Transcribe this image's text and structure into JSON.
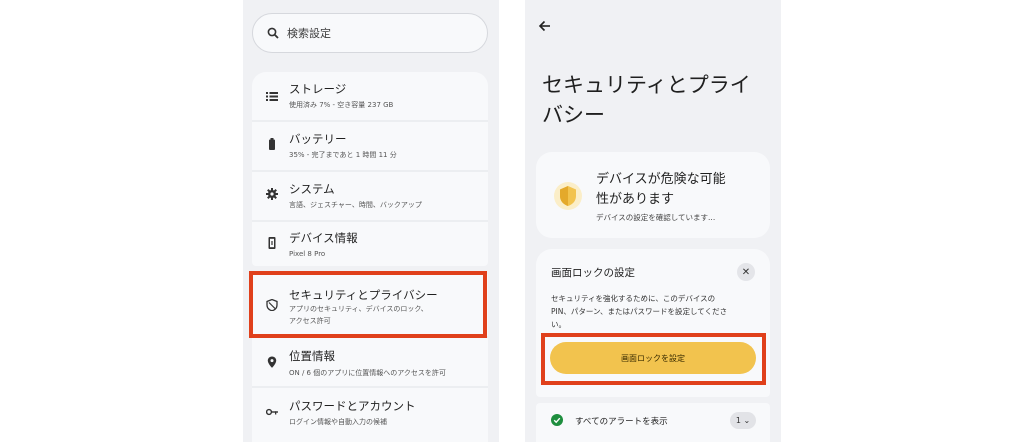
{
  "colors": {
    "accent_highlight": "#e0401b",
    "button_yellow": "#f2c34e",
    "shield_yellow": "#f2c34e",
    "success_green": "#1e8e3e",
    "panel_bg": "#f0f1f4"
  },
  "left": {
    "search": {
      "placeholder": "検索設定",
      "icon": "search-icon"
    },
    "items": [
      {
        "title": "ストレージ",
        "sub": "使用済み 7% - 空き容量 237 GB",
        "icon": "storage-list-icon"
      },
      {
        "title": "バッテリー",
        "sub": "35% - 完了まであと 1 時間 11 分",
        "icon": "battery-icon"
      },
      {
        "title": "システム",
        "sub": "言語、ジェスチャー、時間、バックアップ",
        "icon": "gear-icon"
      },
      {
        "title": "デバイス情報",
        "sub": "Pixel 8 Pro",
        "icon": "phone-info-icon"
      },
      {
        "title": "セキュリティとプライバシー",
        "sub": "アプリのセキュリティ、デバイスのロック、",
        "sub2": "アクセス許可",
        "icon": "shield-icon"
      },
      {
        "title": "位置情報",
        "sub": "ON / 6 個のアプリに位置情報へのアクセスを許可",
        "icon": "location-pin-icon"
      },
      {
        "title": "パスワードとアカウント",
        "sub": "ログイン情報や自動入力の候補",
        "icon": "key-icon"
      }
    ]
  },
  "right": {
    "back_icon": "back-arrow-icon",
    "title_line1": "セキュリティとプライ",
    "title_line2": "バシー",
    "warning": {
      "title_line1": "デバイスが危険な可能",
      "title_line2": "性があります",
      "subtitle": "デバイスの設定を確認しています...",
      "icon": "warning-shield-icon"
    },
    "screen_lock": {
      "title": "画面ロックの設定",
      "close_label": "✕",
      "body_line1": "セキュリティを強化するために、このデバイスの",
      "body_line2": "PIN、パターン、またはパスワードを設定してくださ",
      "body_line3": "い。",
      "button_label": "画面ロックを設定"
    },
    "alerts": {
      "label": "すべてのアラートを表示",
      "count_label": "1 ⌄",
      "icon": "check-circle-icon"
    }
  }
}
